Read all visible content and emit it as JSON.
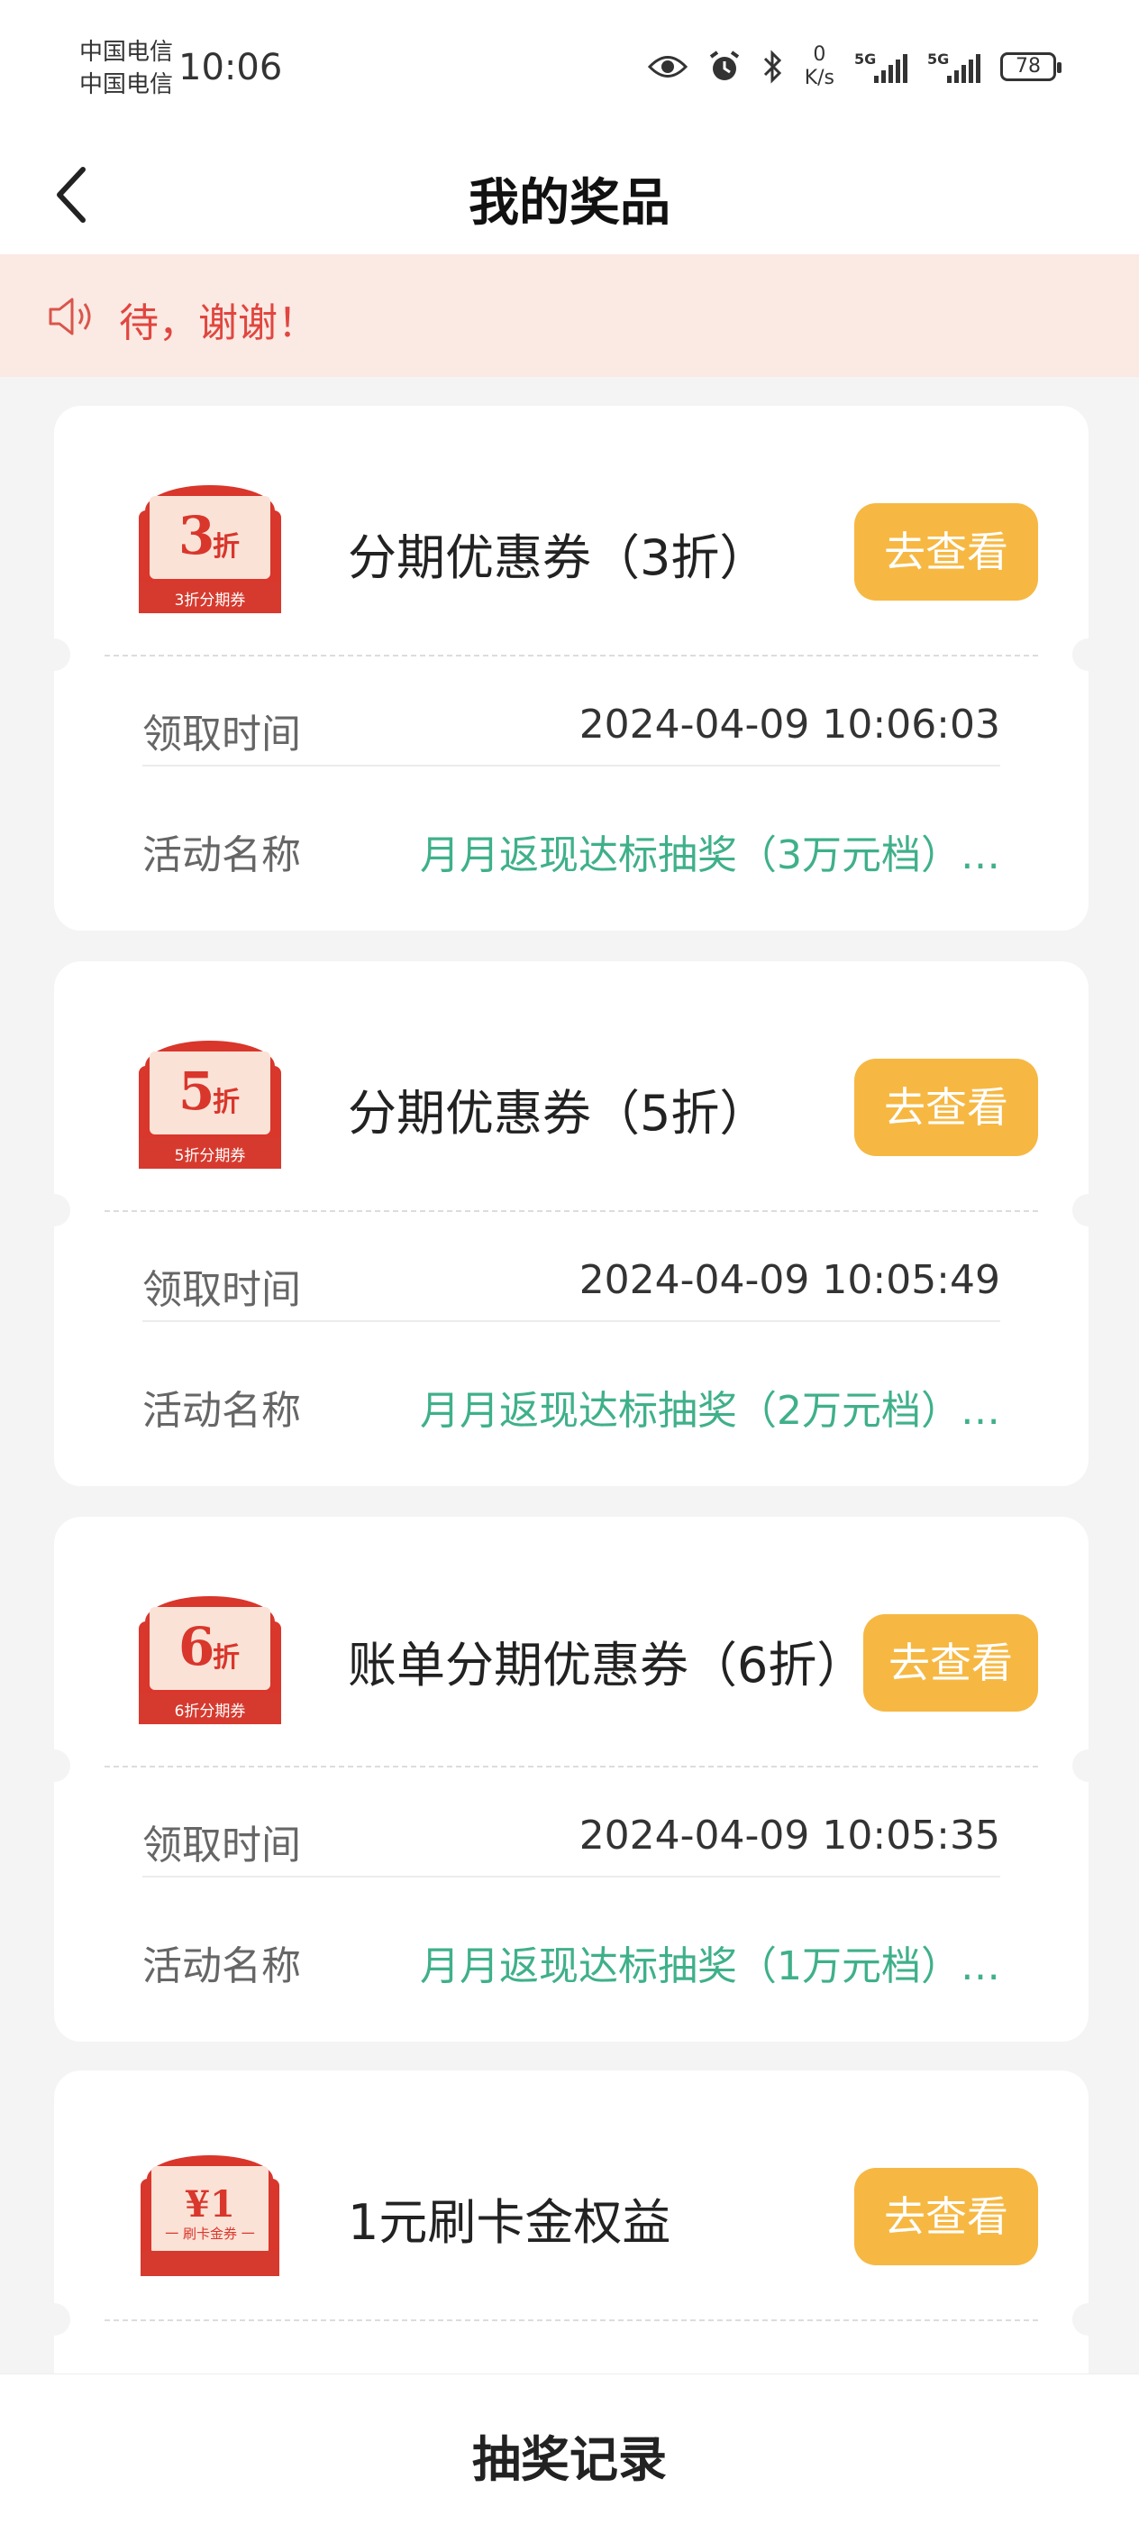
{
  "status_bar": {
    "carrier_1": "中国电信",
    "carrier_2": "中国电信",
    "time": "10:06",
    "net_speed_value": "0",
    "net_speed_unit": "K/s",
    "sim1_tag": "5G",
    "sim2_tag": "5G",
    "battery": "78"
  },
  "header": {
    "title": "我的奖品"
  },
  "notice": {
    "text": "待，谢谢！"
  },
  "labels": {
    "claim_time": "领取时间",
    "activity_name": "活动名称",
    "view_button": "去查看"
  },
  "prizes": [
    {
      "badge_value": "3",
      "badge_unit": "折",
      "badge_caption": "3折分期券",
      "name": "分期优惠券（3折）",
      "claim_time": "2024-04-09 10:06:03",
      "activity": "月月返现达标抽奖（3万元档）…"
    },
    {
      "badge_value": "5",
      "badge_unit": "折",
      "badge_caption": "5折分期券",
      "name": "分期优惠券（5折）",
      "claim_time": "2024-04-09 10:05:49",
      "activity": "月月返现达标抽奖（2万元档）…"
    },
    {
      "badge_value": "6",
      "badge_unit": "折",
      "badge_caption": "6折分期券",
      "name": "账单分期优惠券（6折）",
      "claim_time": "2024-04-09 10:05:35",
      "activity": "月月返现达标抽奖（1万元档）…"
    },
    {
      "badge_value": "¥1",
      "badge_unit": "",
      "badge_caption": "一 刷卡金券 一",
      "name": "1元刷卡金权益",
      "claim_time": "",
      "activity": ""
    }
  ],
  "bottom_bar": {
    "label": "抽奖记录"
  },
  "colors": {
    "accent_button": "#f6b843",
    "activity_text": "#3fb08a",
    "notice_bg": "#fbe9e3",
    "notice_text": "#e0463f",
    "coupon_red": "#d9362c"
  }
}
